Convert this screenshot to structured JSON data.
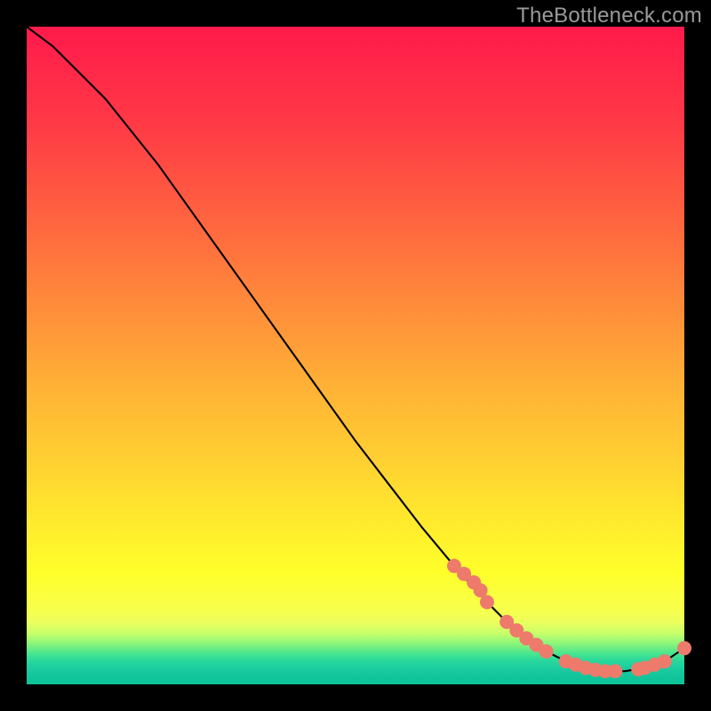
{
  "watermark": "TheBottleneck.com",
  "colors": {
    "background": "#000000",
    "gradient_top": "#ff1a4b",
    "gradient_mid": "#ffe12f",
    "gradient_bottom": "#10c49a",
    "curve": "#000000",
    "marker": "#ee7a6b"
  },
  "chart_data": {
    "type": "line",
    "title": "",
    "xlabel": "",
    "ylabel": "",
    "xlim": [
      0,
      100
    ],
    "ylim": [
      0,
      100
    ],
    "grid": false,
    "legend": false,
    "annotations": [
      "TheBottleneck.com"
    ],
    "series": [
      {
        "name": "bottleneck-curve",
        "x": [
          0,
          4,
          8,
          12,
          16,
          20,
          25,
          30,
          35,
          40,
          45,
          50,
          55,
          60,
          65,
          70,
          73,
          76,
          79,
          82,
          85,
          88,
          91,
          94,
          97,
          100
        ],
        "y": [
          100,
          97,
          93,
          89,
          84,
          79,
          72,
          65,
          58,
          51,
          44,
          37,
          30.5,
          24,
          18,
          12.5,
          9.5,
          7,
          5,
          3.5,
          2.5,
          2,
          2,
          2.5,
          3.5,
          5.5
        ]
      }
    ],
    "markers": {
      "name": "highlighted-points",
      "x": [
        65,
        66.5,
        68,
        69,
        70,
        73,
        74.5,
        76,
        77.5,
        79,
        82,
        83.5,
        85,
        86.5,
        88,
        89.5,
        93,
        94,
        95.5,
        97,
        100
      ],
      "y": [
        18,
        16.8,
        15.5,
        14.3,
        12.5,
        9.5,
        8.2,
        7,
        6,
        5,
        3.5,
        3,
        2.5,
        2.2,
        2,
        2,
        2.3,
        2.5,
        3,
        3.5,
        5.5
      ]
    }
  }
}
